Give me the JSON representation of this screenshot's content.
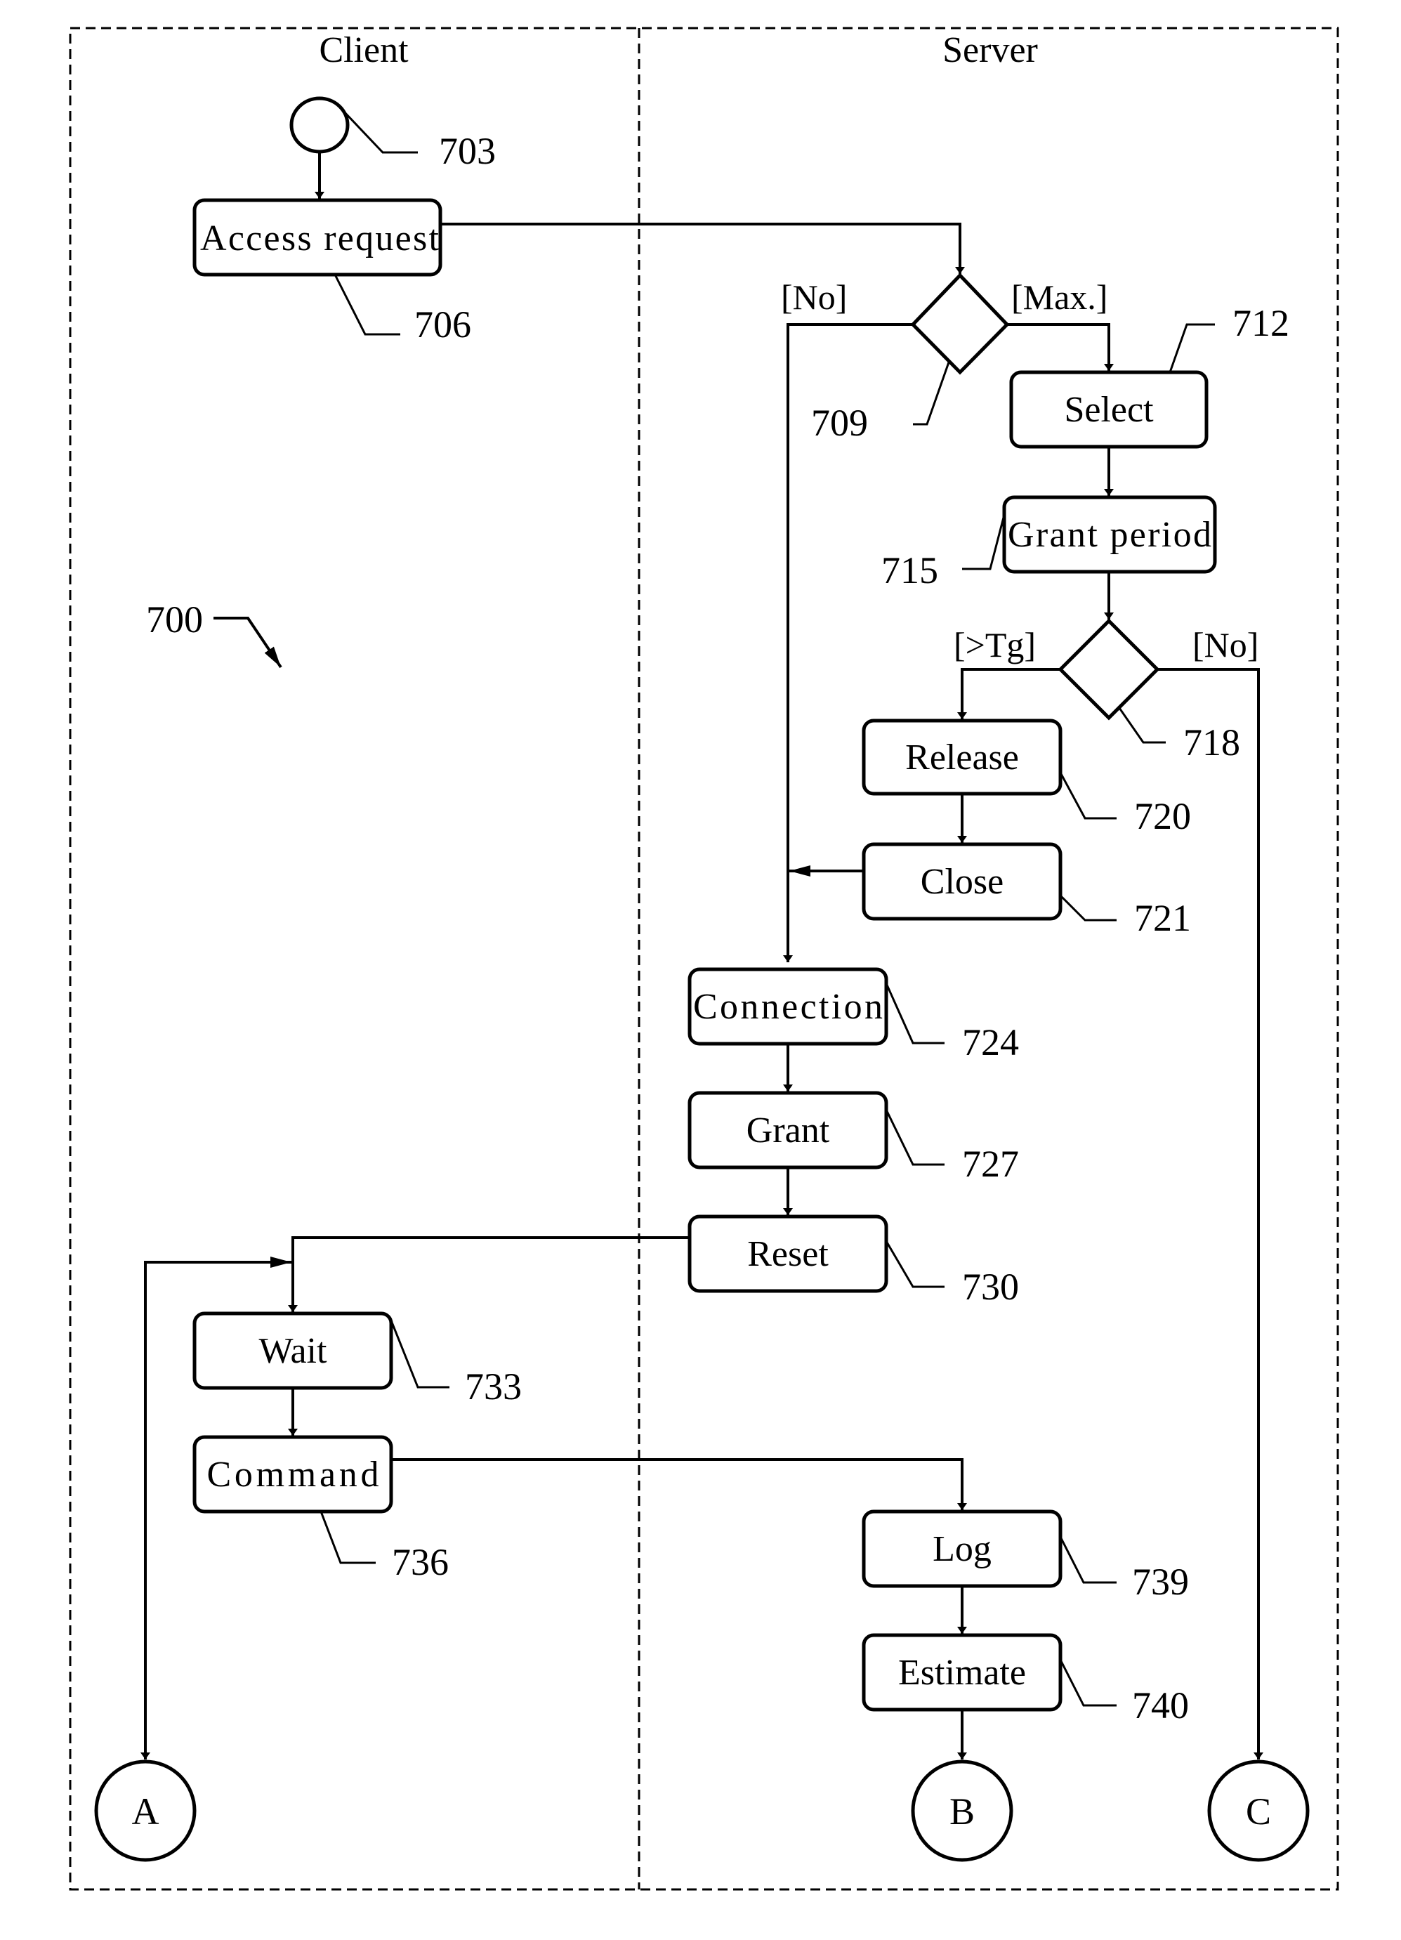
{
  "figure": {
    "ref": "700",
    "lanes": [
      {
        "id": "client",
        "title": "Client"
      },
      {
        "id": "server",
        "title": "Server"
      }
    ],
    "start": {
      "ref": "703"
    },
    "nodes": [
      {
        "id": "access",
        "label": "Access request",
        "ref": "706"
      },
      {
        "id": "select",
        "label": "Select",
        "ref": "712"
      },
      {
        "id": "grantperiod",
        "label": "Grant period",
        "ref": "715"
      },
      {
        "id": "release",
        "label": "Release",
        "ref": "720"
      },
      {
        "id": "close",
        "label": "Close",
        "ref": "721"
      },
      {
        "id": "connection",
        "label": "Connection",
        "ref": "724"
      },
      {
        "id": "grant",
        "label": "Grant",
        "ref": "727"
      },
      {
        "id": "reset",
        "label": "Reset",
        "ref": "730"
      },
      {
        "id": "wait",
        "label": "Wait",
        "ref": "733"
      },
      {
        "id": "command",
        "label": "Command",
        "ref": "736"
      },
      {
        "id": "log",
        "label": "Log",
        "ref": "739"
      },
      {
        "id": "estimate",
        "label": "Estimate",
        "ref": "740"
      }
    ],
    "decisions": [
      {
        "id": "d1",
        "ref": "709",
        "left_guard": "[No]",
        "right_guard": "[Max.]"
      },
      {
        "id": "d2",
        "ref": "718",
        "left_guard": "[>Tg]",
        "right_guard": "[No]"
      }
    ],
    "connectors": [
      {
        "id": "A",
        "label": "A"
      },
      {
        "id": "B",
        "label": "B"
      },
      {
        "id": "C",
        "label": "C"
      }
    ]
  }
}
